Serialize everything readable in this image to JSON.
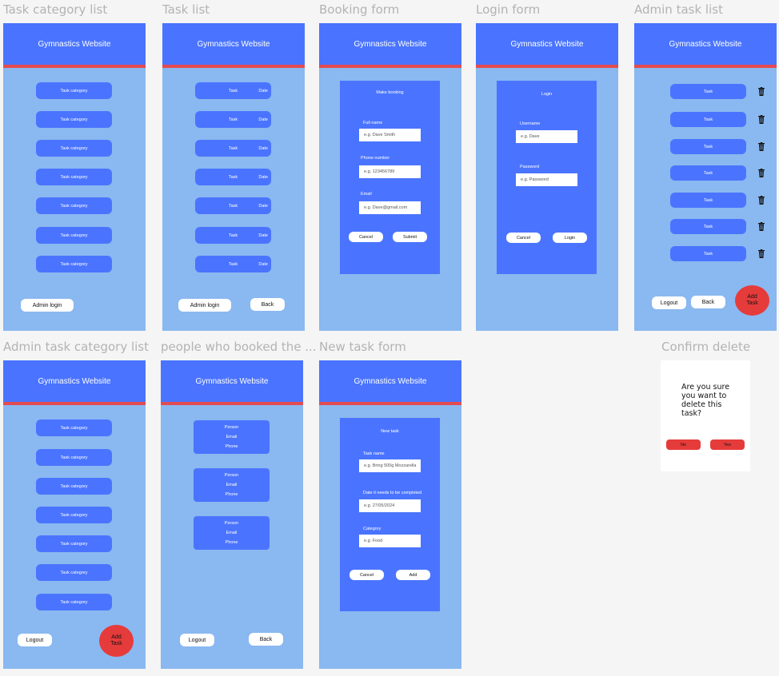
{
  "frames": {
    "task_category_list": "Task category list",
    "task_list": "Task list",
    "booking_form": "Booking form",
    "login_form": "Login form",
    "admin_task_list": "Admin task list",
    "admin_task_category_list": "Admin task category list",
    "people_booked": "people who booked the ...",
    "new_task_form": "New task form",
    "confirm_delete": "Confirm delete"
  },
  "site_title": "Gymnastics Website",
  "labels": {
    "task_category": "Task category",
    "task": "Task",
    "date": "Date",
    "admin_login": "Admin login",
    "back": "Back",
    "logout": "Logout",
    "add_task_line1": "Add",
    "add_task_line2": "Task",
    "cancel": "Cancel",
    "submit": "Submit",
    "login": "Login",
    "add": "Add",
    "person": "Person",
    "email": "Email",
    "phone": "Phone"
  },
  "booking": {
    "heading": "Make booking",
    "full_name_label": "Full name",
    "full_name_placeholder": "e.g. Dave Smith",
    "phone_label": "Phone number",
    "phone_placeholder": "e.g. 123456789",
    "email_label": "Email",
    "email_placeholder": "e.g. Dave@gmail.com"
  },
  "login": {
    "heading": "Login",
    "username_label": "Username",
    "username_placeholder": "e.g. Dave",
    "password_label": "Password",
    "password_placeholder": "e.g. Password"
  },
  "new_task": {
    "heading": "New task",
    "name_label": "Task name",
    "name_placeholder": "e.g. Bring 500g Mozzarella",
    "date_label": "Date it needs to be completed",
    "date_placeholder": "e.g. 27/05/2024",
    "category_label": "Category",
    "category_placeholder": "e.g. Food"
  },
  "confirm": {
    "message": "Are you sure you want to delete this task?",
    "no": "No",
    "yes": "Yes"
  },
  "colors": {
    "frame_bg": "#8ab8f0",
    "header_bg": "#4a74ff",
    "header_stripe": "#e44b50",
    "danger": "#e63b3b"
  },
  "icons": [
    "trash-icon"
  ]
}
